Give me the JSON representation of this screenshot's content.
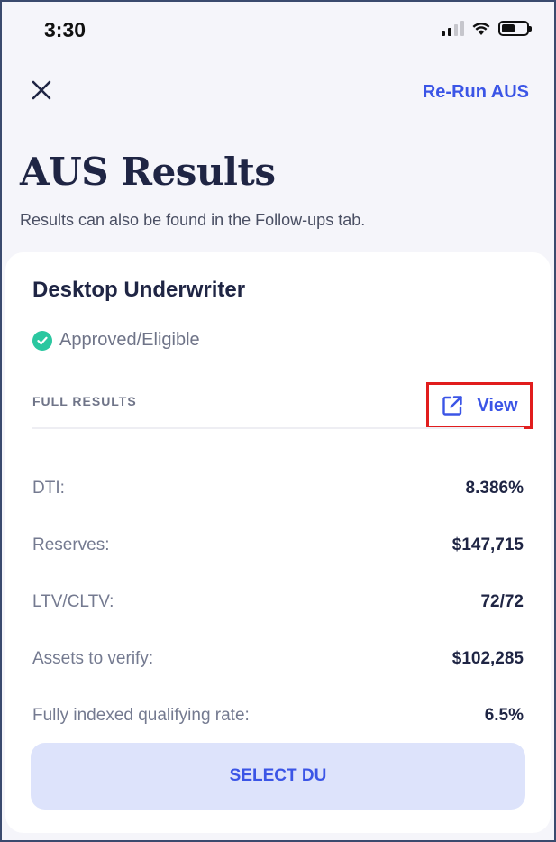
{
  "status_bar": {
    "time": "3:30"
  },
  "header": {
    "rerun_label": "Re-Run AUS"
  },
  "page": {
    "title": "AUS Results",
    "subtitle": "Results can also be found in the Follow-ups tab."
  },
  "card": {
    "title": "Desktop Underwriter",
    "status": "Approved/Eligible",
    "full_results_label": "FULL RESULTS",
    "view_label": "View",
    "metrics": [
      {
        "label": "DTI:",
        "value": "8.386%"
      },
      {
        "label": "Reserves:",
        "value": "$147,715"
      },
      {
        "label": "LTV/CLTV:",
        "value": "72/72"
      },
      {
        "label": "Assets to verify:",
        "value": "$102,285"
      },
      {
        "label": "Fully indexed qualifying rate:",
        "value": "6.5%"
      }
    ],
    "select_label": "SELECT DU"
  },
  "colors": {
    "accent": "#3b55e6",
    "success": "#2bc7a0",
    "highlight_box": "#e11d1d",
    "title_text": "#1f2544"
  },
  "icons": {
    "close": "close-icon",
    "view": "external-link-icon",
    "status": "check-circle-icon"
  }
}
